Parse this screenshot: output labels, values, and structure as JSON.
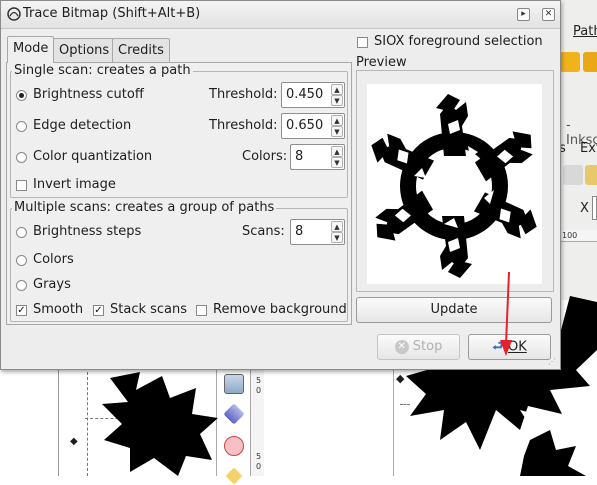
{
  "dialog": {
    "title": "Trace Bitmap (Shift+Alt+B)",
    "tabs": [
      "Mode",
      "Options",
      "Credits"
    ],
    "active_tab": "Mode",
    "siox_label": "SIOX foreground selection",
    "siox_checked": false,
    "single_scan": {
      "legend": "Single scan: creates a path",
      "brightness": {
        "label": "Brightness cutoff",
        "selected": true,
        "param_label": "Threshold:",
        "value": "0.450"
      },
      "edge": {
        "label": "Edge detection",
        "selected": false,
        "param_label": "Threshold:",
        "value": "0.650"
      },
      "color_quant": {
        "label": "Color quantization",
        "selected": false,
        "param_label": "Colors:",
        "value": "8"
      },
      "invert": {
        "label": "Invert image",
        "checked": false
      }
    },
    "multiple_scans": {
      "legend": "Multiple scans: creates a group of paths",
      "brightness_steps": {
        "label": "Brightness steps",
        "selected": false,
        "param_label": "Scans:",
        "value": "8"
      },
      "colors": {
        "label": "Colors",
        "selected": false
      },
      "grays": {
        "label": "Grays",
        "selected": false
      },
      "smooth": {
        "label": "Smooth",
        "checked": true
      },
      "stack": {
        "label": "Stack scans",
        "checked": true
      },
      "remove_bg": {
        "label": "Remove background",
        "checked": false
      }
    },
    "preview": {
      "legend": "Preview",
      "update_label": "Update"
    },
    "stop_label": "Stop",
    "ok_label": "OK"
  },
  "background": {
    "menu_path": "Path",
    "window_title_fragment": "- Inksc",
    "menu_extensions_fragment": "Ext",
    "menu_s_fragment": "s",
    "x_label": "X",
    "ruler_number": "100",
    "ruler_vertical_digits": [
      "5",
      "0",
      "5",
      "0"
    ]
  },
  "colors": {
    "arrow": "#e8202a",
    "snowflake": "#000000",
    "dialog_bg": "#ededed"
  }
}
